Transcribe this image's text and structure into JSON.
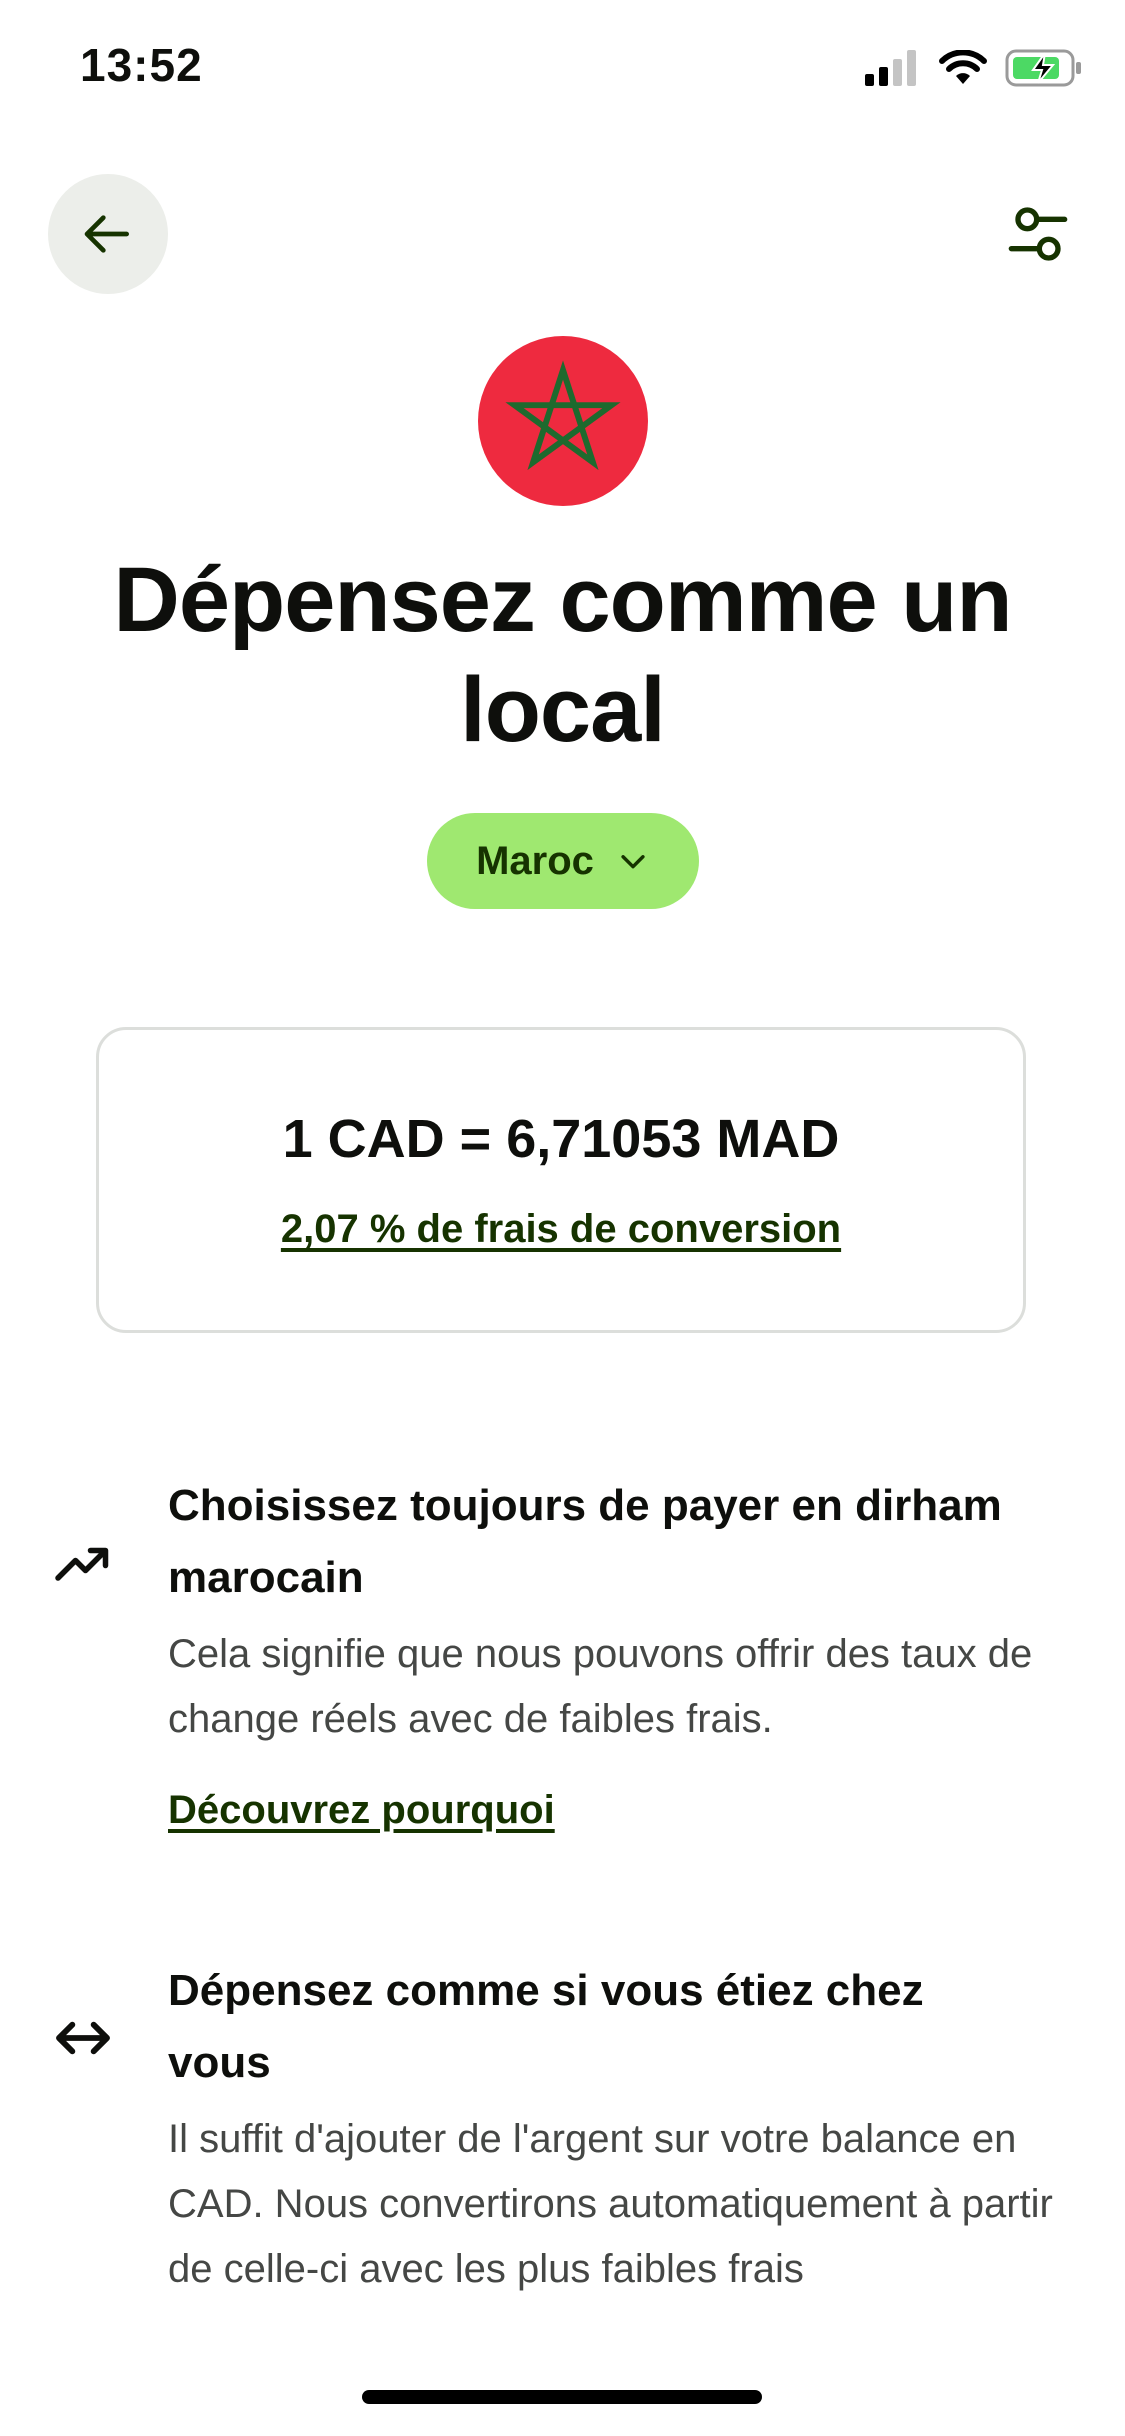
{
  "status_bar": {
    "time": "13:52"
  },
  "header": {
    "back_icon": "arrow-left-icon",
    "filter_icon": "sliders-icon"
  },
  "flag": {
    "icon": "morocco-flag-icon",
    "colors": {
      "red": "#ee2a3f",
      "star": "#1e6a2e"
    }
  },
  "title": "Dépensez comme un local",
  "country_selector": {
    "label": "Maroc",
    "icon": "chevron-down-icon"
  },
  "rate_card": {
    "rate": "1 CAD = 6,71053  MAD",
    "fee_link": "2,07  % de frais de conversion"
  },
  "features": [
    {
      "icon": "trending-up-icon",
      "title": "Choisissez toujours de payer en dirham marocain",
      "body": "Cela signifie que nous pouvons offrir des taux de change réels avec de faibles frais.",
      "link": "Découvrez pourquoi"
    },
    {
      "icon": "arrows-left-right-icon",
      "title": "Dépensez comme si vous étiez chez vous",
      "body": "Il suffit d'ajouter de l'argent sur votre balance en CAD. Nous convertirons automatiquement à partir de celle-ci avec les plus faibles frais"
    }
  ],
  "colors": {
    "accent": "#9fe870",
    "dark_green": "#163300",
    "text": "#0e0f0c",
    "muted": "#454745"
  }
}
